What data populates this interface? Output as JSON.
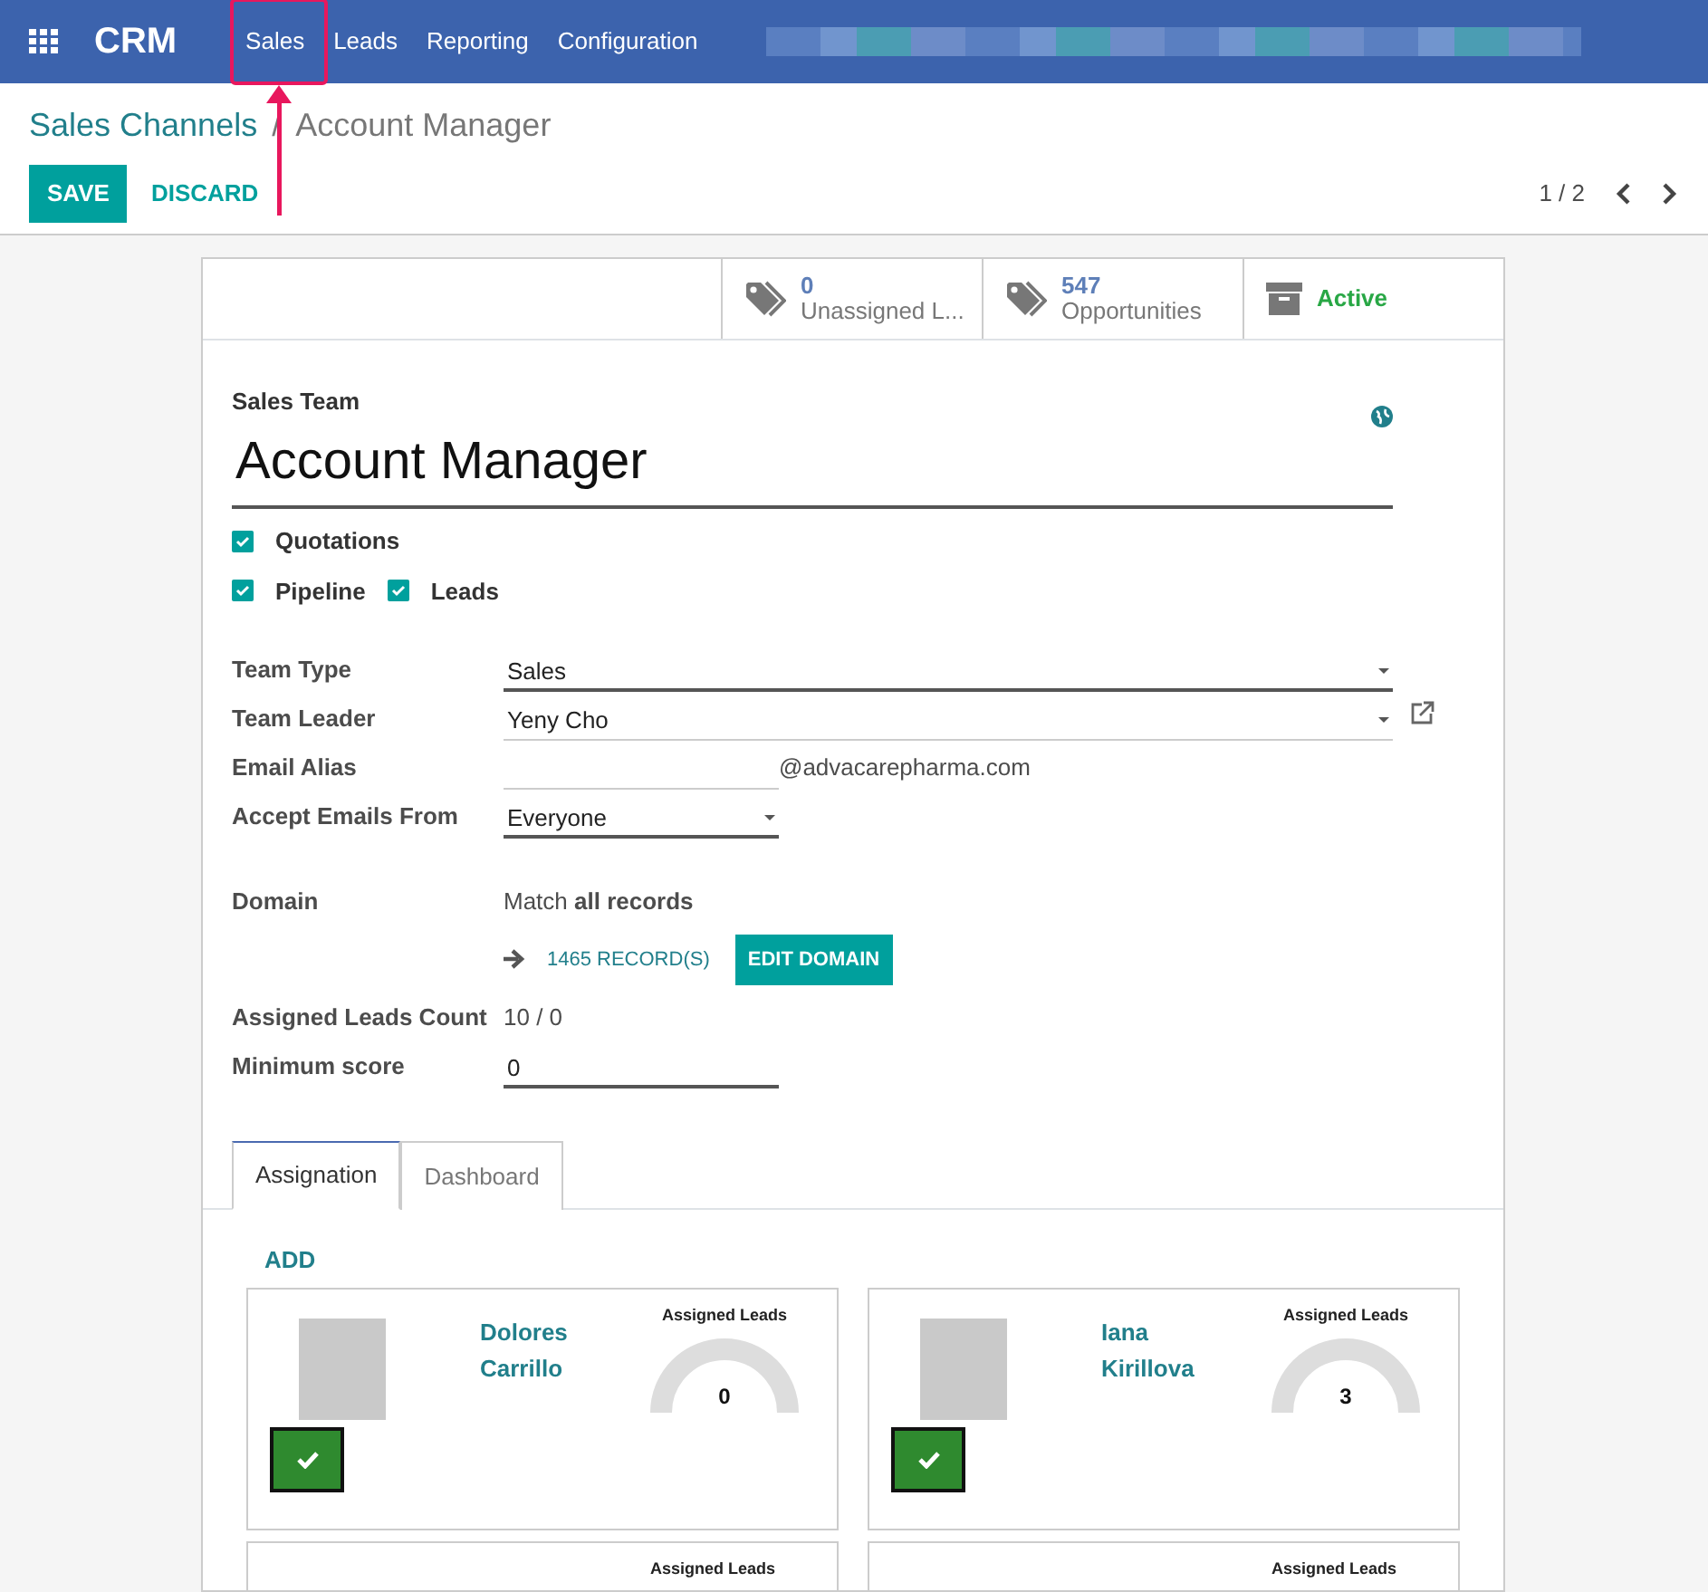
{
  "navbar": {
    "app": "CRM",
    "menu": [
      {
        "label": "Sales",
        "selected": false,
        "annotated": true
      },
      {
        "label": "Leads",
        "selected": false,
        "annotated": false
      },
      {
        "label": "Reporting",
        "selected": false,
        "annotated": false
      },
      {
        "label": "Configuration",
        "selected": false,
        "annotated": false
      }
    ]
  },
  "breadcrumb": {
    "items": [
      "Sales Channels",
      "Account Manager"
    ],
    "separator": "/"
  },
  "buttons": [
    {
      "label": "SAVE",
      "kind": "primary"
    },
    {
      "label": "DISCARD",
      "kind": "link"
    }
  ],
  "pager": "1 / 2",
  "stat_buttons": [
    {
      "kind": "stat",
      "value": "0",
      "label": "Unassigned L..."
    },
    {
      "kind": "stat",
      "value": "547",
      "label": "Opportunities"
    },
    {
      "kind": "toggle",
      "label": "Active",
      "on": true
    }
  ],
  "form": {
    "name_label": "Sales Team",
    "name": "Account Manager",
    "checkbox_rows": [
      [
        {
          "label": "Quotations",
          "checked": true
        }
      ],
      [
        {
          "label": "Pipeline",
          "checked": true
        },
        {
          "label": "Leads",
          "checked": true
        }
      ]
    ],
    "fields": [
      {
        "kind": "select",
        "label": "Team Type",
        "value": "Sales"
      },
      {
        "kind": "relation",
        "label": "Team Leader",
        "value": "Yeny Cho"
      },
      {
        "kind": "alias",
        "label": "Email Alias",
        "suffix": "@advacarepharma.com"
      },
      {
        "kind": "short_select",
        "label": "Accept Emails From",
        "value": "Everyone"
      },
      {
        "kind": "domain",
        "label": "Domain",
        "value": "Match **all records**",
        "records": "1465 RECORD(S)",
        "button": "EDIT DOMAIN"
      },
      {
        "kind": "text",
        "label": "Assigned Leads Count",
        "value": "10 / 0"
      },
      {
        "kind": "input",
        "label": "Minimum score",
        "value": "0"
      }
    ]
  },
  "tabs": [
    {
      "label": "Assignation",
      "selected": true
    },
    {
      "label": "Dashboard",
      "selected": false
    }
  ],
  "add_link": "ADD",
  "members": [
    {
      "name": "Dolores Carrillo",
      "gauge_title": "Assigned Leads",
      "gauge_value": "0",
      "active": true
    },
    {
      "name": "Iana Kirillova",
      "gauge_title": "Assigned Leads",
      "gauge_value": "3",
      "active": true
    },
    {
      "gauge_title": "Assigned Leads"
    },
    {
      "gauge_title": "Assigned Leads"
    }
  ]
}
